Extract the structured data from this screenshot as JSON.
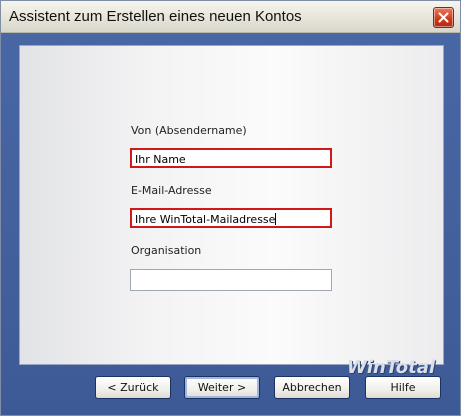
{
  "window": {
    "title": "Assistent zum Erstellen eines neuen Kontos",
    "close_icon": "close-icon"
  },
  "form": {
    "sender_label": "Von (Absendername)",
    "sender_value": "Ihr Name",
    "email_label": "E-Mail-Adresse",
    "email_value": "Ihre WinTotal-Mailadresse",
    "org_label": "Organisation",
    "org_value": ""
  },
  "watermark": "WinTotal",
  "buttons": {
    "back": "< Zurück",
    "next": "Weiter >",
    "cancel": "Abbrechen",
    "help": "Hilfe"
  },
  "colors": {
    "window_frame": "#3e5a96",
    "highlight_border": "#d01818",
    "close_button": "#c8391a"
  }
}
